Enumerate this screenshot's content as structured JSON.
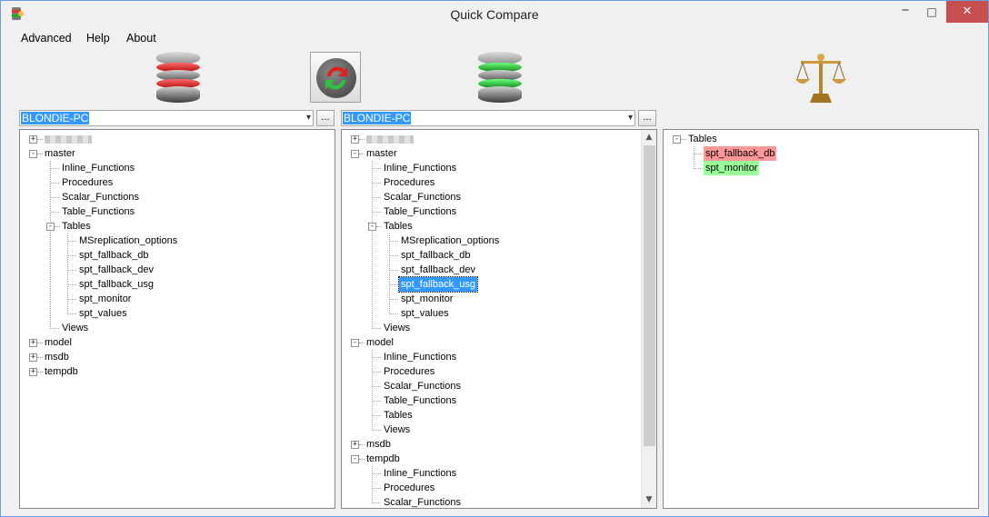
{
  "window": {
    "title": "Quick Compare",
    "min": "─",
    "max": "□",
    "close": "✕"
  },
  "menu": [
    "Advanced",
    "Help",
    "About"
  ],
  "left": {
    "server": "BLONDIE-PC",
    "browse": "...",
    "tree": [
      {
        "depth": 0,
        "label": "",
        "blurred": true,
        "exp": "+"
      },
      {
        "depth": 0,
        "label": "master",
        "exp": "−"
      },
      {
        "depth": 1,
        "label": "Inline_Functions"
      },
      {
        "depth": 1,
        "label": "Procedures"
      },
      {
        "depth": 1,
        "label": "Scalar_Functions"
      },
      {
        "depth": 1,
        "label": "Table_Functions"
      },
      {
        "depth": 1,
        "label": "Tables",
        "exp": "−"
      },
      {
        "depth": 2,
        "label": "MSreplication_options"
      },
      {
        "depth": 2,
        "label": "spt_fallback_db"
      },
      {
        "depth": 2,
        "label": "spt_fallback_dev"
      },
      {
        "depth": 2,
        "label": "spt_fallback_usg"
      },
      {
        "depth": 2,
        "label": "spt_monitor"
      },
      {
        "depth": 2,
        "label": "spt_values"
      },
      {
        "depth": 1,
        "label": "Views"
      },
      {
        "depth": 0,
        "label": "model",
        "exp": "+"
      },
      {
        "depth": 0,
        "label": "msdb",
        "exp": "+"
      },
      {
        "depth": 0,
        "label": "tempdb",
        "exp": "+"
      }
    ]
  },
  "middle": {
    "server": "BLONDIE-PC",
    "browse": "...",
    "tree": [
      {
        "depth": 0,
        "label": "",
        "blurred": true,
        "exp": "+"
      },
      {
        "depth": 0,
        "label": "master",
        "exp": "−"
      },
      {
        "depth": 1,
        "label": "Inline_Functions"
      },
      {
        "depth": 1,
        "label": "Procedures"
      },
      {
        "depth": 1,
        "label": "Scalar_Functions"
      },
      {
        "depth": 1,
        "label": "Table_Functions"
      },
      {
        "depth": 1,
        "label": "Tables",
        "exp": "−"
      },
      {
        "depth": 2,
        "label": "MSreplication_options"
      },
      {
        "depth": 2,
        "label": "spt_fallback_db"
      },
      {
        "depth": 2,
        "label": "spt_fallback_dev"
      },
      {
        "depth": 2,
        "label": "spt_fallback_usg",
        "selected": true
      },
      {
        "depth": 2,
        "label": "spt_monitor"
      },
      {
        "depth": 2,
        "label": "spt_values"
      },
      {
        "depth": 1,
        "label": "Views"
      },
      {
        "depth": 0,
        "label": "model",
        "exp": "−"
      },
      {
        "depth": 1,
        "label": "Inline_Functions"
      },
      {
        "depth": 1,
        "label": "Procedures"
      },
      {
        "depth": 1,
        "label": "Scalar_Functions"
      },
      {
        "depth": 1,
        "label": "Table_Functions"
      },
      {
        "depth": 1,
        "label": "Tables"
      },
      {
        "depth": 1,
        "label": "Views"
      },
      {
        "depth": 0,
        "label": "msdb",
        "exp": "+"
      },
      {
        "depth": 0,
        "label": "tempdb",
        "exp": "−"
      },
      {
        "depth": 1,
        "label": "Inline_Functions"
      },
      {
        "depth": 1,
        "label": "Procedures"
      },
      {
        "depth": 1,
        "label": "Scalar_Functions"
      }
    ]
  },
  "result": {
    "tree": [
      {
        "depth": 0,
        "label": "Tables",
        "exp": "−"
      },
      {
        "depth": 1,
        "label": "spt_fallback_db",
        "status": "diff-red"
      },
      {
        "depth": 1,
        "label": "spt_monitor",
        "status": "diff-green"
      }
    ]
  },
  "colors": {
    "accent": "#3399ff",
    "diff_red": "#ff9999",
    "diff_green": "#99ff99",
    "db_left": "#d62828",
    "db_right": "#1fae2e"
  }
}
